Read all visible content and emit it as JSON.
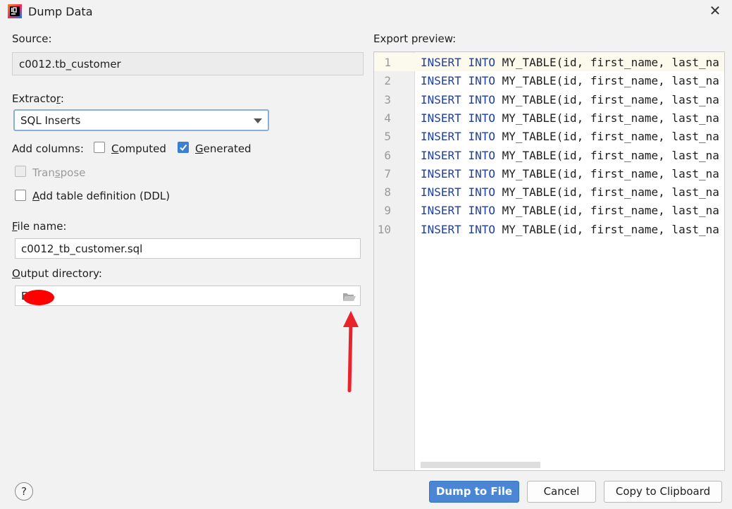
{
  "window": {
    "title": "Dump Data"
  },
  "source": {
    "label": "Source:",
    "value": "c0012.tb_customer"
  },
  "extractor": {
    "label_pre": "Extracto",
    "label_mn": "r",
    "label_post": ":",
    "selected": "SQL Inserts"
  },
  "add_columns": {
    "label": "Add columns:",
    "computed": {
      "mn": "C",
      "rest": "omputed",
      "checked": false
    },
    "generated": {
      "mn": "G",
      "rest": "enerated",
      "checked": true
    }
  },
  "transpose": {
    "pre": "Tran",
    "mn": "s",
    "post": "pose",
    "checked": false,
    "disabled": true
  },
  "ddl": {
    "mn": "A",
    "rest": "dd table definition (DDL)",
    "checked": false
  },
  "file_name": {
    "mn": "F",
    "rest": "ile name:",
    "value": "c0012_tb_customer.sql"
  },
  "output_dir": {
    "mn": "O",
    "rest": "utput directory:",
    "value": "E"
  },
  "preview": {
    "label": "Export preview:",
    "lines": [
      {
        "no": "1",
        "kw1": "INSERT",
        "kw2": "INTO",
        "code": "MY_TABLE(id, first_name, last_na"
      },
      {
        "no": "2",
        "kw1": "INSERT",
        "kw2": "INTO",
        "code": "MY_TABLE(id, first_name, last_na"
      },
      {
        "no": "3",
        "kw1": "INSERT",
        "kw2": "INTO",
        "code": "MY_TABLE(id, first_name, last_na"
      },
      {
        "no": "4",
        "kw1": "INSERT",
        "kw2": "INTO",
        "code": "MY_TABLE(id, first_name, last_na"
      },
      {
        "no": "5",
        "kw1": "INSERT",
        "kw2": "INTO",
        "code": "MY_TABLE(id, first_name, last_na"
      },
      {
        "no": "6",
        "kw1": "INSERT",
        "kw2": "INTO",
        "code": "MY_TABLE(id, first_name, last_na"
      },
      {
        "no": "7",
        "kw1": "INSERT",
        "kw2": "INTO",
        "code": "MY_TABLE(id, first_name, last_na"
      },
      {
        "no": "8",
        "kw1": "INSERT",
        "kw2": "INTO",
        "code": "MY_TABLE(id, first_name, last_na"
      },
      {
        "no": "9",
        "kw1": "INSERT",
        "kw2": "INTO",
        "code": "MY_TABLE(id, first_name, last_na"
      },
      {
        "no": "10",
        "kw1": "INSERT",
        "kw2": "INTO",
        "code": "MY_TABLE(id, first_name, last_na"
      }
    ]
  },
  "buttons": {
    "help": "?",
    "dump": "Dump to File",
    "cancel": "Cancel",
    "copy": "Copy to Clipboard"
  },
  "colors": {
    "accent": "#4a86d4",
    "keyword": "#1e3ea0",
    "arrow": "#e8242a"
  },
  "icons": {
    "app": "intellij-icon",
    "close": "close-icon",
    "folder": "folder-open-icon",
    "dropdown": "chevron-down-icon"
  }
}
